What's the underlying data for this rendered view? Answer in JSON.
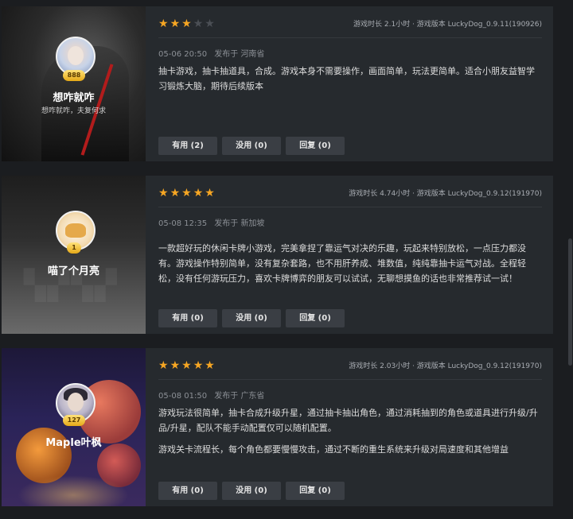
{
  "reviews": [
    {
      "username": "想咋就咋",
      "signature": "想咋就咋，夫复何求",
      "level": "888",
      "rating": 3,
      "stars": [
        "on",
        "on",
        "on",
        "off",
        "off"
      ],
      "meta": "游戏时长 2.1小时 · 游戏版本 LuckyDog_0.9.11(190926)",
      "date": "05-06 20:50",
      "location_prefix": "发布于",
      "location": "河南省",
      "paragraphs": [
        "抽卡游戏，抽卡抽道具，合成。游戏本身不需要操作，画面简单，玩法更简单。适合小朋友益智学习锻炼大脑，期待后续版本"
      ],
      "useful_label": "有用 (2)",
      "useless_label": "没用 (0)",
      "reply_label": "回复 (0)"
    },
    {
      "username": "喵了个月亮",
      "signature": "",
      "level": "1",
      "rating": 5,
      "stars": [
        "on",
        "on",
        "on",
        "on",
        "on"
      ],
      "meta": "游戏时长 4.74小时 · 游戏版本 LuckyDog_0.9.12(191970)",
      "date": "05-08 12:35",
      "location_prefix": "发布于",
      "location": "新加坡",
      "paragraphs": [
        "一款超好玩的休闲卡牌小游戏，完美拿捏了靠运气对决的乐趣，玩起来特别放松，一点压力都没有。游戏操作特别简单，没有复杂套路，也不用肝养成、堆数值，纯纯靠抽卡运气对战。全程轻松，没有任何游玩压力，喜欢卡牌博弈的朋友可以试试，无聊想摸鱼的话也非常推荐试一试！"
      ],
      "useful_label": "有用 (0)",
      "useless_label": "没用 (0)",
      "reply_label": "回复 (0)"
    },
    {
      "username": "Maple叶枫",
      "signature": "",
      "level": "127",
      "rating": 5,
      "stars": [
        "on",
        "on",
        "on",
        "on",
        "on"
      ],
      "meta": "游戏时长 2.03小时 · 游戏版本 LuckyDog_0.9.12(191970)",
      "date": "05-08 01:50",
      "location_prefix": "发布于",
      "location": "广东省",
      "paragraphs": [
        "游戏玩法很简单，抽卡合成升级升星，通过抽卡抽出角色，通过消耗抽到的角色或道具进行升级/升品/升星，配队不能手动配置仅可以随机配置。",
        "游戏关卡流程长，每个角色都要慢慢攻击，通过不断的重生系统来升级对局速度和其他增益"
      ],
      "useful_label": "有用 (0)",
      "useless_label": "没用 (0)",
      "reply_label": "回复 (0)"
    }
  ],
  "colors": {
    "star_on": "#f6a623",
    "star_off": "#4b4f55",
    "card_bg": "#262a2e",
    "page_bg": "#1b1d20",
    "button_bg": "#3a3e44"
  },
  "icons": {
    "star": "star-icon",
    "avatar": "avatar"
  }
}
